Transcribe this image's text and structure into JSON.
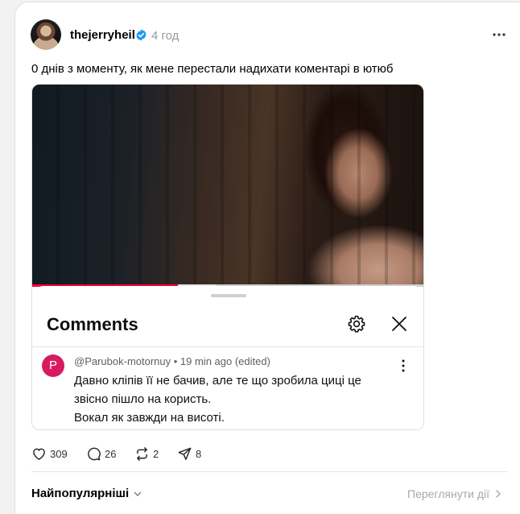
{
  "post": {
    "username": "thejerryheil",
    "time": "4 год",
    "text": "0 днів з моменту, як мене перестали надихати коментарі в ютюб"
  },
  "video": {
    "progress_fraction": 0.37,
    "buffer_fraction": 0.47
  },
  "comments_sheet": {
    "title": "Comments",
    "comment": {
      "avatar_letter": "P",
      "meta": "@Parubok-motornuy • 19 min ago (edited)",
      "lines": [
        "Давно кліпів її не бачив, але те що зробила циці це",
        "звісно пішло на користь.",
        "Вокал як завжди на висоті."
      ]
    }
  },
  "actions": {
    "likes": "309",
    "comments": "26",
    "reposts": "2",
    "shares": "8"
  },
  "footer": {
    "sort_label": "Найпопулярніші",
    "view_activity": "Переглянути дії"
  },
  "colors": {
    "verified": "#1d9bf0",
    "progress": "#ff0033",
    "comment_avatar": "#d81b60"
  }
}
